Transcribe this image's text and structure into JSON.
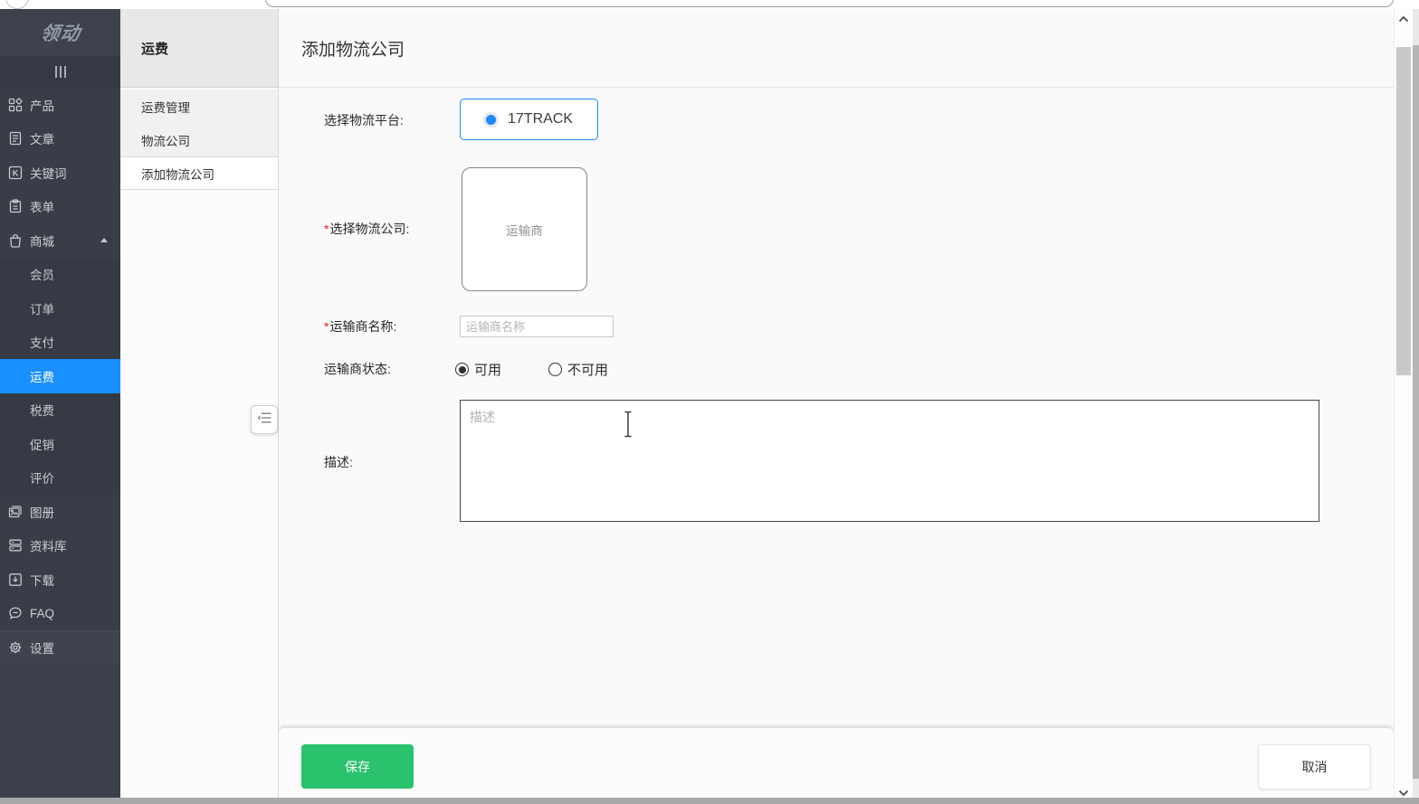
{
  "app_logo": "领动",
  "sidebar": {
    "items": [
      {
        "id": "products",
        "label": "产品",
        "icon": "appstore-icon",
        "type": "top"
      },
      {
        "id": "articles",
        "label": "文章",
        "icon": "article-icon",
        "type": "top"
      },
      {
        "id": "keywords",
        "label": "关键词",
        "icon": "keyword-icon",
        "type": "top"
      },
      {
        "id": "forms",
        "label": "表单",
        "icon": "form-icon",
        "type": "top"
      },
      {
        "id": "mall",
        "label": "商城",
        "icon": "mall-icon",
        "type": "top",
        "expanded": true
      },
      {
        "id": "members",
        "label": "会员",
        "type": "sub"
      },
      {
        "id": "orders",
        "label": "订单",
        "type": "sub"
      },
      {
        "id": "payment",
        "label": "支付",
        "type": "sub"
      },
      {
        "id": "shipping",
        "label": "运费",
        "type": "sub",
        "active": true
      },
      {
        "id": "tax",
        "label": "税费",
        "type": "sub"
      },
      {
        "id": "promotion",
        "label": "促销",
        "type": "sub"
      },
      {
        "id": "reviews",
        "label": "评价",
        "type": "sub"
      },
      {
        "id": "albums",
        "label": "图册",
        "icon": "album-icon",
        "type": "top"
      },
      {
        "id": "library",
        "label": "资料库",
        "icon": "library-icon",
        "type": "top"
      },
      {
        "id": "download",
        "label": "下载",
        "icon": "download-icon",
        "type": "top"
      },
      {
        "id": "faq",
        "label": "FAQ",
        "icon": "faq-icon",
        "type": "top"
      },
      {
        "id": "settings",
        "label": "设置",
        "icon": "settings-icon",
        "type": "top",
        "pinned": true
      }
    ]
  },
  "secondary": {
    "title": "运费",
    "items": [
      {
        "id": "shipping-management",
        "label": "运费管理"
      },
      {
        "id": "logistics-company",
        "label": "物流公司"
      },
      {
        "id": "add-logistics-company",
        "label": "添加物流公司",
        "active": true
      }
    ]
  },
  "main": {
    "title": "添加物流公司",
    "form": {
      "required_mark": "*",
      "platform_label": "选择物流平台:",
      "platform_option": "17TRACK",
      "platform_selected": true,
      "company_label": "选择物流公司:",
      "company_box_text": "运输商",
      "name_label": "运输商名称:",
      "name_value": "",
      "name_placeholder": "运输商名称",
      "status_label": "运输商状态:",
      "status_options": [
        {
          "label": "可用",
          "selected": true
        },
        {
          "label": "不可用",
          "selected": false
        }
      ],
      "desc_label": "描述:",
      "desc_value": "",
      "desc_placeholder": "描述"
    },
    "footer": {
      "save_label": "保存",
      "cancel_label": "取消"
    }
  },
  "colors": {
    "sidebar_dark": "#3b404a",
    "active_menu_blue": "#1890ff",
    "accent_blue": "#1e88ff",
    "save_green": "#2bc26e",
    "required_red": "#e02020"
  }
}
